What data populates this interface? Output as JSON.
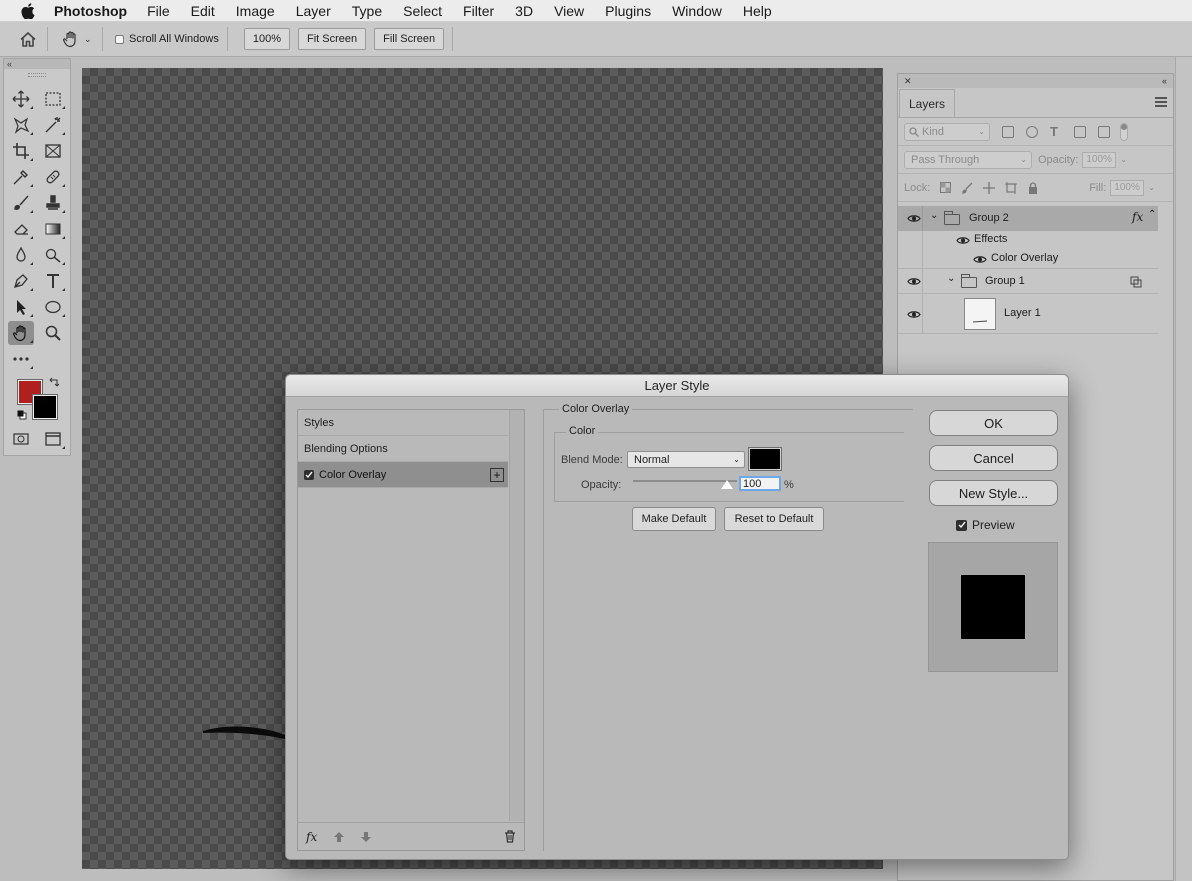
{
  "menubar": {
    "app": "Photoshop",
    "items": [
      "File",
      "Edit",
      "Image",
      "Layer",
      "Type",
      "Select",
      "Filter",
      "3D",
      "View",
      "Plugins",
      "Window",
      "Help"
    ]
  },
  "options": {
    "scroll_all": "Scroll All Windows",
    "zoom_btn": "100%",
    "fit_btn": "Fit Screen",
    "fill_btn": "Fill Screen"
  },
  "colors": {
    "foreground": "#b0201e",
    "background": "#000000",
    "overlay": "#000000"
  },
  "layers_panel": {
    "tab": "Layers",
    "kind_placeholder": "Kind",
    "blend_mode": "Pass Through",
    "opacity_label": "Opacity:",
    "opacity_value": "100%",
    "lock_label": "Lock:",
    "fill_label": "Fill:",
    "fill_value": "100%",
    "layers": [
      {
        "name": "Group 2",
        "fx": "fx"
      },
      {
        "name": "Effects"
      },
      {
        "name": "Color Overlay"
      },
      {
        "name": "Group 1"
      },
      {
        "name": "Layer 1"
      }
    ]
  },
  "dialog": {
    "title": "Layer Style",
    "styles": [
      "Styles",
      "Blending Options",
      "Color Overlay"
    ],
    "section_title": "Color Overlay",
    "group_title": "Color",
    "blend_mode_label": "Blend Mode:",
    "blend_mode_value": "Normal",
    "opacity_label": "Opacity:",
    "opacity_value": "100",
    "opacity_unit": "%",
    "opacity_fraction": 1.0,
    "make_default": "Make Default",
    "reset_default": "Reset to Default",
    "ok": "OK",
    "cancel": "Cancel",
    "new_style": "New Style...",
    "preview": "Preview",
    "footer_fx": "fx"
  }
}
